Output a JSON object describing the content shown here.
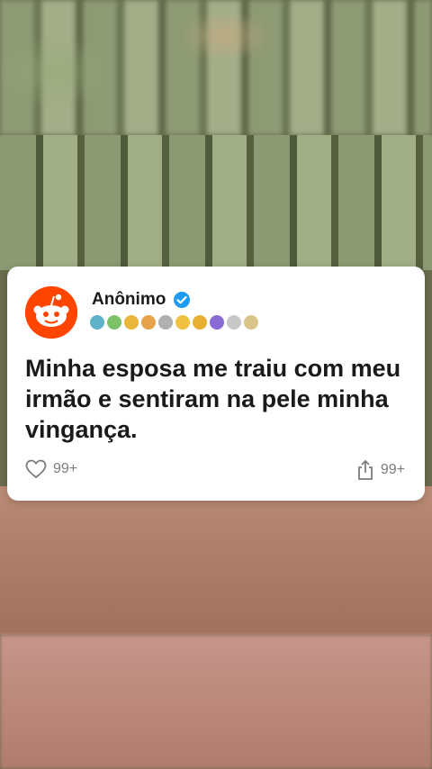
{
  "post": {
    "username": "Anônimo",
    "text": "Minha esposa me traiu com meu irmão e sentiram na pele minha vingança.",
    "likes": "99+",
    "shares": "99+"
  },
  "colors": {
    "avatar_bg": "#ff4500",
    "verified": "#1d9bf0",
    "text": "#1a1a1b",
    "muted": "#7c7c7c"
  },
  "icons": {
    "avatar": "reddit-snoo-icon",
    "verified": "verified-badge-icon",
    "like": "heart-outline-icon",
    "share": "share-icon"
  },
  "badges": [
    "award-badge-icon",
    "award-badge-icon",
    "award-badge-icon",
    "award-badge-icon",
    "award-badge-icon",
    "award-badge-icon",
    "award-badge-icon",
    "award-badge-icon",
    "award-badge-icon",
    "award-badge-icon"
  ]
}
